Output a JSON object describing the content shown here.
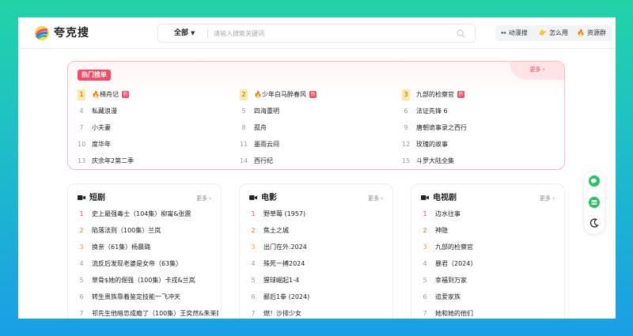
{
  "header": {
    "brand": "夸克搜",
    "search": {
      "scope": "全部",
      "placeholder": "请输入搜索关键词"
    },
    "buttons": [
      {
        "icon": "↔",
        "label": "动漫搜"
      },
      {
        "icon": "👉",
        "label": "怎么用"
      },
      {
        "icon": "🔥",
        "label": "资源群"
      }
    ]
  },
  "hot": {
    "badge": "热门搜单",
    "more": "更多 ›",
    "items": [
      {
        "rank": "1",
        "title": "梯舟记",
        "fire": true,
        "hot": true
      },
      {
        "rank": "2",
        "title": "少年白马醉春风",
        "fire": true,
        "hot": true
      },
      {
        "rank": "3",
        "title": "九部的检察官",
        "fire": false,
        "hot": true
      },
      {
        "rank": "4",
        "title": "私藏浪漫"
      },
      {
        "rank": "5",
        "title": "四海重明"
      },
      {
        "rank": "6",
        "title": "法证先锋 6"
      },
      {
        "rank": "7",
        "title": "小夫妻"
      },
      {
        "rank": "8",
        "title": "孤舟"
      },
      {
        "rank": "9",
        "title": "唐朝诡事录之西行"
      },
      {
        "rank": "10",
        "title": "度华年"
      },
      {
        "rank": "11",
        "title": "墨雨云间"
      },
      {
        "rank": "12",
        "title": "玫瑰的故事"
      },
      {
        "rank": "13",
        "title": "庆余年2第二季"
      },
      {
        "rank": "14",
        "title": "西行纪"
      },
      {
        "rank": "15",
        "title": "斗罗大陆全集"
      }
    ]
  },
  "cards": [
    {
      "title": "短剧",
      "more": "更多 ›",
      "items": [
        {
          "rank": "1",
          "title": "史上最强毒士（104集）柳甯&张震"
        },
        {
          "rank": "2",
          "title": "陷落法则（100集）兰岚"
        },
        {
          "rank": "3",
          "title": "换亲（61集）杨晨璐"
        },
        {
          "rank": "4",
          "title": "流反后发现老婆是女帝（63集）"
        },
        {
          "rank": "5",
          "title": "草骨$她的倔强（100集）卡戎&兰岚"
        },
        {
          "rank": "6",
          "title": "转生贵族靠着鉴定技能一飞冲天"
        },
        {
          "rank": "7",
          "title": "祁先生他暗恋成瘾了（100集）王奕然&朱茉颜"
        }
      ]
    },
    {
      "title": "电影",
      "more": "更多 ›",
      "items": [
        {
          "rank": "1",
          "title": "野草莓 (1957)"
        },
        {
          "rank": "2",
          "title": "焦土之城"
        },
        {
          "rank": "3",
          "title": "出门在外.2024"
        },
        {
          "rank": "4",
          "title": "殊死一搏2024"
        },
        {
          "rank": "5",
          "title": "猩球崛起1-4"
        },
        {
          "rank": "6",
          "title": "鄙后1拳 (2024)"
        },
        {
          "rank": "7",
          "title": "燃！沙排少女"
        }
      ]
    },
    {
      "title": "电视剧",
      "more": "更多 ›",
      "items": [
        {
          "rank": "1",
          "title": "边水往事"
        },
        {
          "rank": "2",
          "title": "神隐"
        },
        {
          "rank": "3",
          "title": "九部的检察官"
        },
        {
          "rank": "4",
          "title": "暴君（2024）"
        },
        {
          "rank": "5",
          "title": "幸福到万家"
        },
        {
          "rank": "6",
          "title": "追爱家族"
        },
        {
          "rank": "7",
          "title": "她和她的他们"
        }
      ]
    }
  ],
  "colors": {
    "accent": "#f54b63",
    "rank1": "#f43f4b",
    "rank2": "#f56b2a",
    "rank3": "#f59e1b"
  }
}
